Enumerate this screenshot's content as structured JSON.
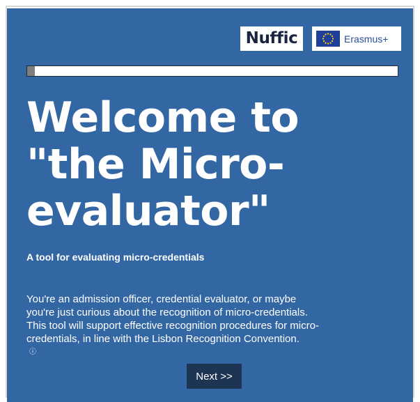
{
  "logos": {
    "nuffic": "Nuffic",
    "erasmus": "Erasmus+",
    "eu_flag_icon": "eu-flag-icon"
  },
  "progress": {
    "fraction": 0.02,
    "fill_color": "#7f7f7f"
  },
  "title_lines": [
    "Welcome to",
    "\"the Micro-",
    "evaluator\""
  ],
  "subtitle": "A tool for evaluating micro-credentials",
  "description_lines": [
    "You're an admission officer, credential evaluator, or maybe",
    "you're just curious about the recognition of micro-credentials.",
    "This tool will support effective recognition procedures for micro-",
    "credentials, in line with the Lisbon Recognition Convention."
  ],
  "info_icon": "ⓘ",
  "next_button": "Next >>",
  "colors": {
    "panel_background": "#3367a4",
    "button_background": "#1d3453",
    "text": "#ffffff"
  }
}
